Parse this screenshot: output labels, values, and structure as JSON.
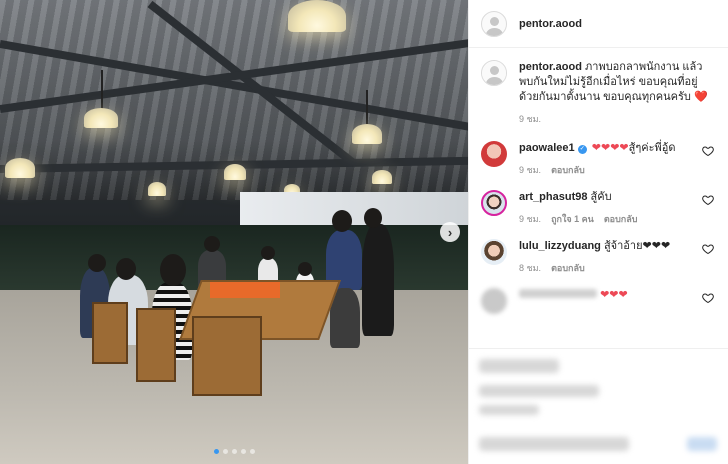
{
  "post": {
    "author": "pentor.aood",
    "carousel": {
      "slide_count": 5,
      "active_slide": 1
    }
  },
  "caption": {
    "username": "pentor.aood",
    "text": "ภาพบอกลาพนักงาน แล้วพบกันใหม่ไม่รู้อีกเมื่อไหร่ ขอบคุณที่อยู่ด้วยกันมาตั้งนาน ขอบคุณทุกคนครับ",
    "emoji": "❤️",
    "time": "9 ชม."
  },
  "comments": [
    {
      "username": "paowalee1",
      "verified": true,
      "hearts": "❤❤❤❤",
      "text": "สู้ๆค่ะพี่อู้ด",
      "time": "9 ชม.",
      "likes": "",
      "reply": "ตอบกลับ"
    },
    {
      "username": "art_phasut98",
      "verified": false,
      "hearts": "",
      "text": "สู้คับ",
      "time": "9 ชม.",
      "likes": "ถูกใจ 1 คน",
      "reply": "ตอบกลับ"
    },
    {
      "username": "lulu_lizzyduang",
      "verified": false,
      "hearts": "",
      "text": "สู้จ้าอ้าย❤❤❤",
      "time": "8 ชม.",
      "likes": "",
      "reply": "ตอบกลับ"
    },
    {
      "username": "",
      "verified": false,
      "hearts": "",
      "text": "❤❤❤",
      "time": "",
      "likes": "",
      "reply": ""
    }
  ],
  "icons": {
    "heart": "heart-outline-icon",
    "next": "chevron-right-icon",
    "verified": "verified-badge-icon"
  },
  "colors": {
    "heart_red": "#ed4956",
    "verified_blue": "#3897f0",
    "meta_gray": "#8e8e8e"
  }
}
